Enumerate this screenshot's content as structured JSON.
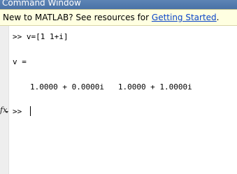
{
  "window": {
    "title": "Command Window"
  },
  "infobar": {
    "prefix": "New to MATLAB? See resources for ",
    "link_text": "Getting Started",
    "suffix": "."
  },
  "console": {
    "command_line": ">> v=[1 1+i]",
    "variable_line": "v =",
    "output_line": "1.0000 + 0.0000i   1.0000 + 1.0000i",
    "prompt": ">> "
  },
  "icons": {
    "function_browser": "fx-icon"
  },
  "colors": {
    "title_bar": "#4a72a6",
    "info_bar_background": "#ffffe1",
    "link": "#0b45c8",
    "gutter": "#eeeeee"
  }
}
